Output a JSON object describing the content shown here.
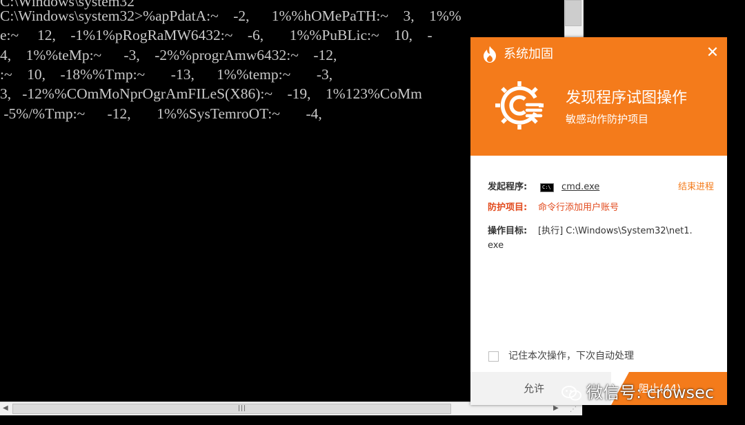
{
  "console": {
    "lines": [
      "C:\\Windows\\system32>%apPdatA:~    -2,      1%%hOMePaTH:~    3,    1%%",
      "e:~     12,    -1%1%pRogRaMW6432:~    -6,       1%%PuBLic:~    10,    -",
      "4,    1%%teMp:~      -3,    -2%%progrAmw6432:~    -12,",
      ":~    10,    -18%%Tmp:~       -13,      1%%temp:~       -3,",
      "3,   -12%%COmMoNprOgrAmFILeS(X86):~    -19,    1%123%CoMm",
      " -5%/%Tmp:~      -12,       1%%SysTemroOT:~       -4,"
    ]
  },
  "popup": {
    "title": "系统加固",
    "headline": "发现程序试图操作",
    "subheadline": "敏感动作防护项目",
    "initiator_label": "发起程序:",
    "initiator_value": "cmd.exe",
    "end_process": "结束进程",
    "protect_label": "防护项目:",
    "protect_value": "命令行添加用户账号",
    "target_label": "操作目标:",
    "target_value": "[执行] C:\\Windows\\System32\\net1.",
    "target_value_cont": "exe",
    "remember_label": "记住本次操作，下次自动处理",
    "allow_label": "允许",
    "block_label": "阻止(44)",
    "colors": {
      "accent": "#f47b1b",
      "danger": "#e24a1d"
    }
  },
  "watermark": {
    "text": "微信号: crowsec"
  }
}
